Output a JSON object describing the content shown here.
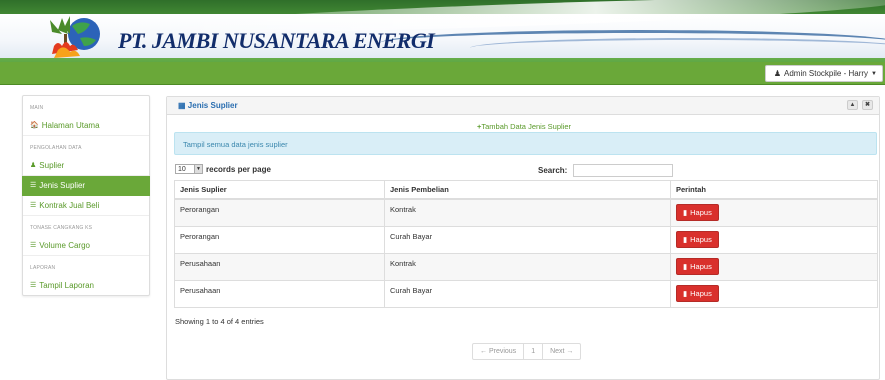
{
  "header": {
    "company": "PT. JAMBI NUSANTARA ENERGI",
    "user_menu": "Admin Stockpile - Harry"
  },
  "sidebar": {
    "sections": [
      {
        "heading": "MAIN",
        "items": [
          {
            "label": "Halaman Utama",
            "icon": "home-icon"
          }
        ]
      },
      {
        "heading": "PENGOLAHAN DATA",
        "items": [
          {
            "label": "Suplier",
            "icon": "user-icon"
          },
          {
            "label": "Jenis Suplier",
            "icon": "list-icon",
            "active": true
          },
          {
            "label": "Kontrak Jual Beli",
            "icon": "list-icon"
          }
        ]
      },
      {
        "heading": "TONASE CANGKANG KS",
        "items": [
          {
            "label": "Volume Cargo",
            "icon": "list-icon"
          }
        ]
      },
      {
        "heading": "LAPORAN",
        "items": [
          {
            "label": "Tampil Laporan",
            "icon": "list-icon"
          }
        ]
      }
    ]
  },
  "panel": {
    "title": "Jenis Suplier",
    "add_link": "Tambah Data Jenis Suplier",
    "alert": "Tampil semua data jenis suplier",
    "length_value": "10",
    "length_label": "records per page",
    "search_label": "Search:",
    "search_value": "",
    "columns": [
      "Jenis Suplier",
      "Jenis Pembelian",
      "Perintah"
    ],
    "rows": [
      {
        "jenis_suplier": "Perorangan",
        "jenis_pembelian": "Kontrak",
        "action": "Hapus"
      },
      {
        "jenis_suplier": "Perorangan",
        "jenis_pembelian": "Curah Bayar",
        "action": "Hapus"
      },
      {
        "jenis_suplier": "Perusahaan",
        "jenis_pembelian": "Kontrak",
        "action": "Hapus"
      },
      {
        "jenis_suplier": "Perusahaan",
        "jenis_pembelian": "Curah Bayar",
        "action": "Hapus"
      }
    ],
    "info": "Showing 1 to 4 of 4 entries",
    "pager": {
      "prev": "← Previous",
      "page": "1",
      "next": "Next →"
    }
  },
  "colors": {
    "green": "#6aa839",
    "danger": "#d9302c",
    "link": "#5a9a2a",
    "title_blue": "#2a6eb0",
    "company_navy": "#122d6b"
  }
}
